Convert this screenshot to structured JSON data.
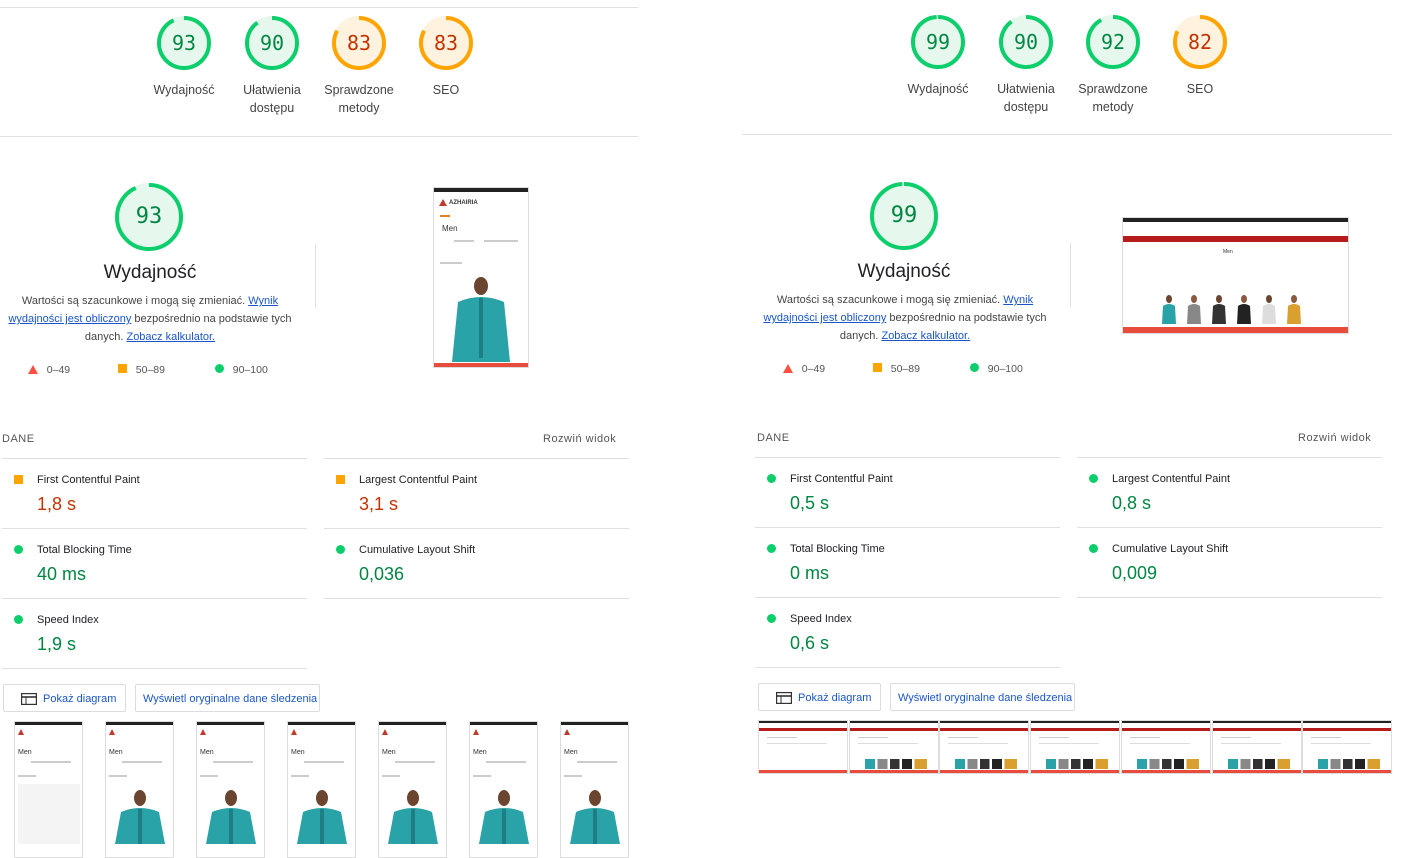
{
  "left": {
    "scores": [
      {
        "value": "93",
        "label": "Wydajność",
        "level": "pass",
        "fraction": 0.93
      },
      {
        "value": "90",
        "label": "Ułatwienia dostępu",
        "level": "pass",
        "fraction": 0.9
      },
      {
        "value": "83",
        "label": "Sprawdzone metody",
        "level": "average",
        "fraction": 0.83
      },
      {
        "value": "83",
        "label": "SEO",
        "level": "average",
        "fraction": 0.83
      }
    ],
    "main_score": {
      "value": "93",
      "title": "Wydajność",
      "fraction": 0.93
    },
    "metrics": [
      {
        "name": "First Contentful Paint",
        "value": "1,8 s",
        "level": "average"
      },
      {
        "name": "Largest Contentful Paint",
        "value": "3,1 s",
        "level": "average"
      },
      {
        "name": "Total Blocking Time",
        "value": "40 ms",
        "level": "pass"
      },
      {
        "name": "Cumulative Layout Shift",
        "value": "0,036",
        "level": "pass"
      },
      {
        "name": "Speed Index",
        "value": "1,9 s",
        "level": "pass"
      }
    ]
  },
  "right": {
    "scores": [
      {
        "value": "99",
        "label": "Wydajność",
        "level": "pass",
        "fraction": 0.99
      },
      {
        "value": "90",
        "label": "Ułatwienia dostępu",
        "level": "pass",
        "fraction": 0.9
      },
      {
        "value": "92",
        "label": "Sprawdzone metody",
        "level": "pass",
        "fraction": 0.92
      },
      {
        "value": "82",
        "label": "SEO",
        "level": "average",
        "fraction": 0.82
      }
    ],
    "main_score": {
      "value": "99",
      "title": "Wydajność",
      "fraction": 0.99
    },
    "metrics": [
      {
        "name": "First Contentful Paint",
        "value": "0,5 s",
        "level": "pass"
      },
      {
        "name": "Largest Contentful Paint",
        "value": "0,8 s",
        "level": "pass"
      },
      {
        "name": "Total Blocking Time",
        "value": "0 ms",
        "level": "pass"
      },
      {
        "name": "Cumulative Layout Shift",
        "value": "0,009",
        "level": "pass"
      },
      {
        "name": "Speed Index",
        "value": "0,6 s",
        "level": "pass"
      }
    ]
  },
  "common": {
    "desc_text_1": "Wartości są szacunkowe i mogą się zmieniać.",
    "desc_link_1": "Wynik wydajności jest obliczony",
    "desc_text_2": "bezpośrednio na podstawie tych danych.",
    "desc_link_2": "Zobacz kalkulator.",
    "legend_fail": "0–49",
    "legend_average": "50–89",
    "legend_pass": "90–100",
    "dane_label": "DANE",
    "expand_label": "Rozwiń widok",
    "show_diagram": "Pokaż diagram",
    "show_trace": "Wyświetl oryginalne dane śledzenia",
    "preview_brand": "AZHAIRIA",
    "preview_heading": "Men"
  },
  "colors": {
    "pass": "#0cce6b",
    "pass_text": "#018642",
    "pass_bg": "#e6f8ee",
    "average": "#ffa400",
    "average_text": "#c33300",
    "average_bg": "#fff3e0",
    "fail": "#ff4e42",
    "link": "#1a56c8"
  }
}
